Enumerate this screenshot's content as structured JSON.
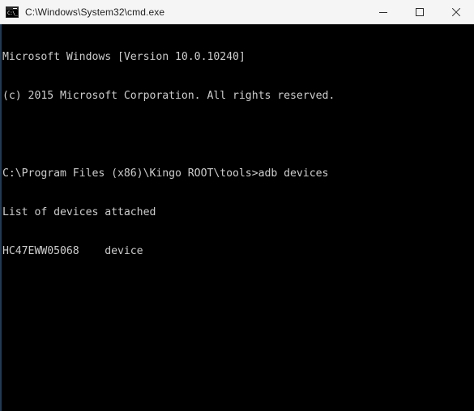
{
  "window": {
    "title": "C:\\Windows\\System32\\cmd.exe",
    "icon_name": "cmd-exe-icon",
    "icon_glyph": "C:\\_",
    "background_color": "#000000",
    "titlebar_color": "#f5f5f5",
    "text_color": "#cccccc"
  },
  "controls": {
    "minimize_label": "Minimize",
    "maximize_label": "Maximize",
    "close_label": "Close"
  },
  "terminal": {
    "prompt": "C:\\Program Files (x86)\\Kingo ROOT\\tools>",
    "command": "adb devices",
    "device_serial": "HC47EWW05068",
    "device_state": "device",
    "lines": [
      "Microsoft Windows [Version 10.0.10240]",
      "(c) 2015 Microsoft Corporation. All rights reserved.",
      "",
      "C:\\Program Files (x86)\\Kingo ROOT\\tools>adb devices",
      "List of devices attached",
      "HC47EWW05068    device"
    ]
  }
}
